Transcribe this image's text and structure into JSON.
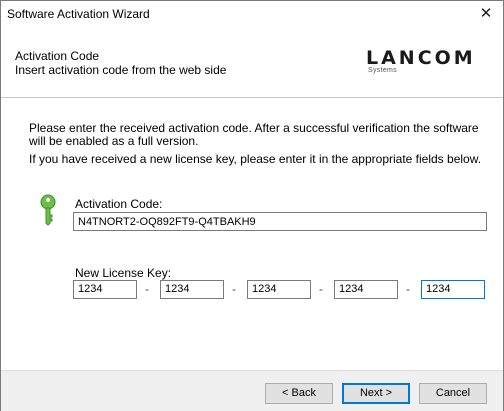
{
  "window": {
    "title": "Software Activation Wizard",
    "close_glyph": "✕"
  },
  "header": {
    "title": "Activation Code",
    "subtitle": "Insert activation code from the web side",
    "logo_text": "LANCOM",
    "logo_subtext": "Systems"
  },
  "content": {
    "instruction_1": "Please enter the received activation code. After a successful verification the software will be enabled as a full version.",
    "instruction_2": "If you have received a new license key, please enter it in the appropriate fields below.",
    "key_icon": "key-icon",
    "key_icon_color": "#6cc04a",
    "activation_code_label": "Activation Code:",
    "activation_code_value": "N4TNORT2-OQ892FT9-Q4TBAKH9",
    "new_license_key_label": "New License Key:",
    "license_key_fields": [
      "1234",
      "1234",
      "1234",
      "1234",
      "1234"
    ],
    "separator": "-"
  },
  "footer": {
    "back_label": "< Back",
    "next_label": "Next >",
    "cancel_label": "Cancel"
  }
}
